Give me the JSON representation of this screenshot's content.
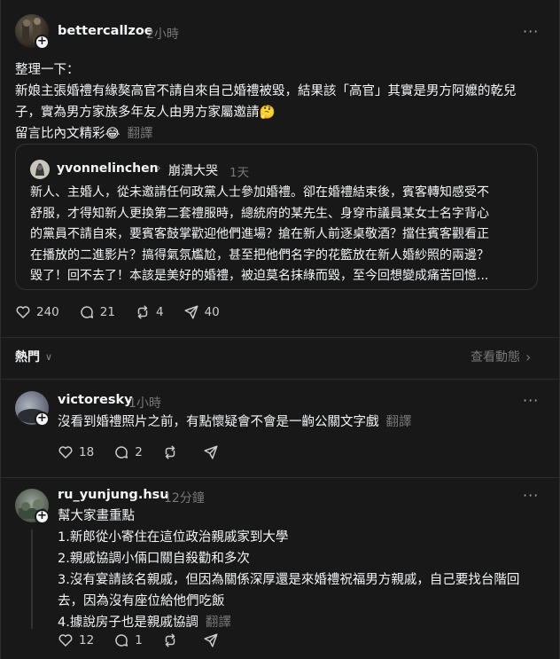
{
  "post": {
    "username": "bettercallzoe",
    "time": "2小時",
    "lines": [
      "整理一下：",
      "新娘主張婚禮有緣獒高官不請自來自己婚禮被毀，結果該「高官」其實是男方阿嬤的乾兒",
      "子，實為男方家族多年友人由男方家屬邀請🤔",
      "留言比內文精彩😂"
    ],
    "translate": "翻譯",
    "quote": {
      "username": "yvonnelinchen",
      "topic": "崩潰大哭",
      "time": "1天",
      "lines": [
        "新人、主婚人，從未邀請任何政黨人士參加婚禮。卻在婚禮結束後，賓客轉知感受不",
        "舒服，才得知新人更換第二套禮服時，總統府的某先生、身穿市議員某女士名字背心",
        "的黨員不請自來，要賓客鼓掌歡迎他們進場？搶在新人前逐桌敬酒？擋住賓客觀看正",
        "在播放的二進影片？搞得氣氛尷尬，甚至把他們名字的花籃放在新人婚紗照的兩邊？",
        "毀了！回不去了！本該是美好的婚禮，被迫莫名抹綠而毀，至今回想變成痛苦回憶..."
      ]
    },
    "likes": "240",
    "replies": "21",
    "reposts": "4",
    "shares": "40"
  },
  "sort": {
    "label": "熱門",
    "activity": "查看動態"
  },
  "comments": [
    {
      "username": "victoresky",
      "time": "1小時",
      "lines": [
        "沒看到婚禮照片之前，有點懷疑會不會是一齣公關文字戲"
      ],
      "translate": "翻譯",
      "likes": "18",
      "replies": "2"
    },
    {
      "username": "ru_yunjung.hsu",
      "time": "12分鐘",
      "lines": [
        "幫大家畫重點",
        "1.新郎從小寄住在這位政治親戚家到大學",
        "2.親戚協調小倆口關自殺勸和多次",
        "3.沒有宴請該名親戚，但因為關係深厚還是來婚禮祝福男方親戚，自己要找台階回",
        "去，因為沒有座位給他們吃飯",
        "4.據說房子也是親戚協調"
      ],
      "translate": "翻譯",
      "likes": "12",
      "replies": "1"
    }
  ]
}
